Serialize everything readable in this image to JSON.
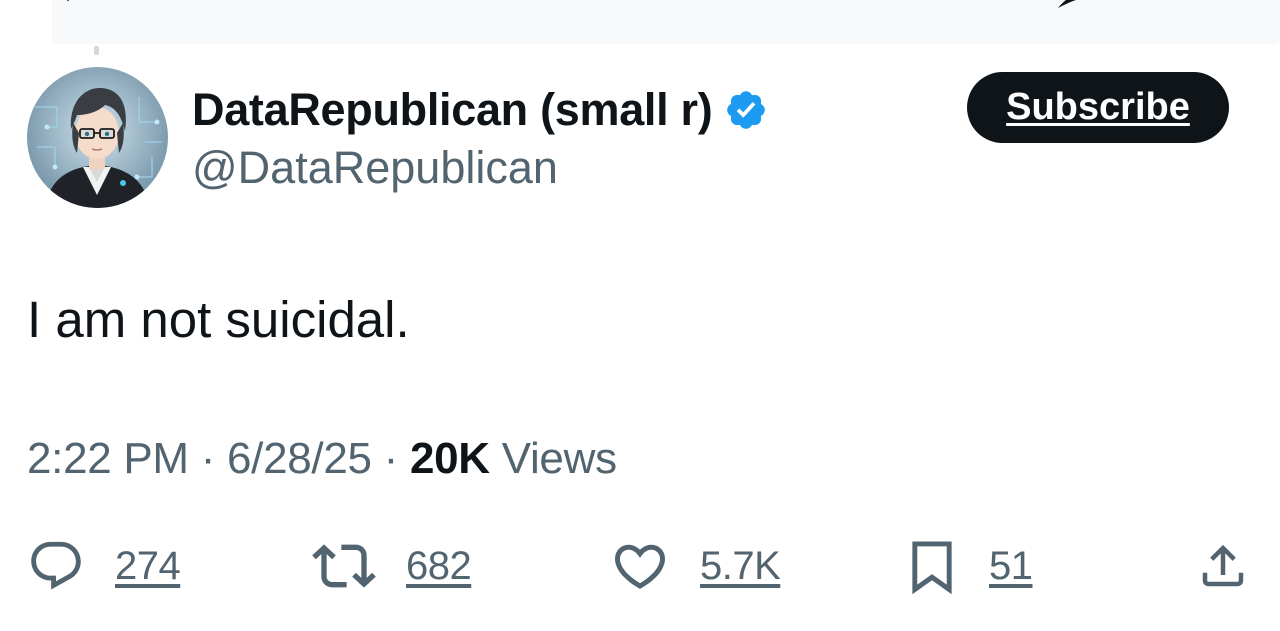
{
  "author": {
    "display_name": "DataRepublican (small r)",
    "handle": "@DataRepublican",
    "verified": true,
    "verified_color": "#1d9bf0"
  },
  "subscribe_button": {
    "label": "Subscribe"
  },
  "tweet": {
    "text": "I am not suicidal.",
    "time": "2:22 PM",
    "separator": "·",
    "date": "6/28/25",
    "views_count": "20K",
    "views_label": "Views"
  },
  "actions": {
    "reply": {
      "icon": "reply-icon",
      "count": "274"
    },
    "retweet": {
      "icon": "retweet-icon",
      "count": "682"
    },
    "like": {
      "icon": "heart-icon",
      "count": "5.7K"
    },
    "bookmark": {
      "icon": "bookmark-icon",
      "count": "51"
    },
    "share": {
      "icon": "share-icon"
    }
  },
  "colors": {
    "text_primary": "#0f1419",
    "text_secondary": "#536471",
    "accent": "#1d9bf0",
    "button_bg": "#0f1419"
  }
}
